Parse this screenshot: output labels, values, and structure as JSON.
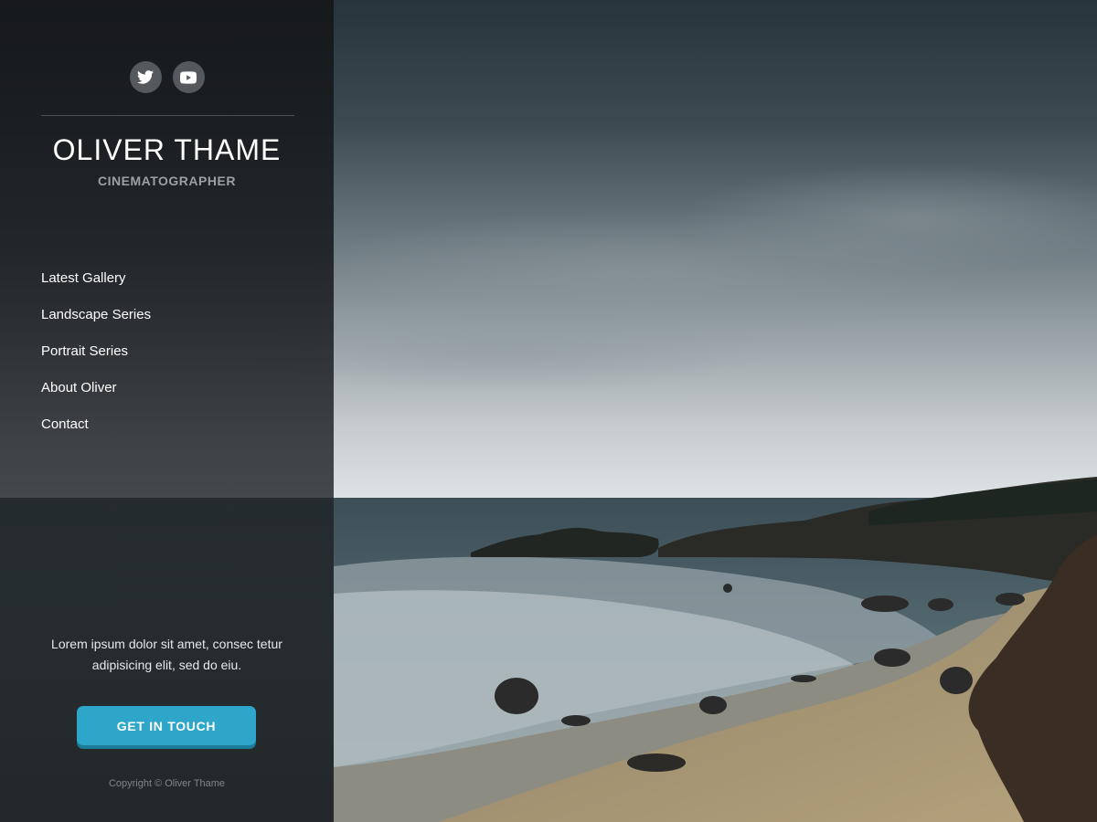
{
  "profile": {
    "name": "OLIVER THAME",
    "role": "CINEMATOGRAPHER"
  },
  "social": [
    {
      "icon": "twitter-icon"
    },
    {
      "icon": "youtube-icon"
    }
  ],
  "nav": {
    "items": [
      {
        "label": "Latest Gallery"
      },
      {
        "label": "Landscape Series"
      },
      {
        "label": "Portrait Series"
      },
      {
        "label": "About Oliver"
      },
      {
        "label": "Contact"
      }
    ]
  },
  "intro": {
    "text": "Lorem ipsum dolor sit amet, consec tetur adipisicing elit, sed do eiu."
  },
  "cta": {
    "label": "GET IN TOUCH"
  },
  "footer": {
    "copyright": "Copyright © Oliver Thame"
  },
  "colors": {
    "accent": "#2ea6c9",
    "sidebar": "#1c1f23"
  }
}
